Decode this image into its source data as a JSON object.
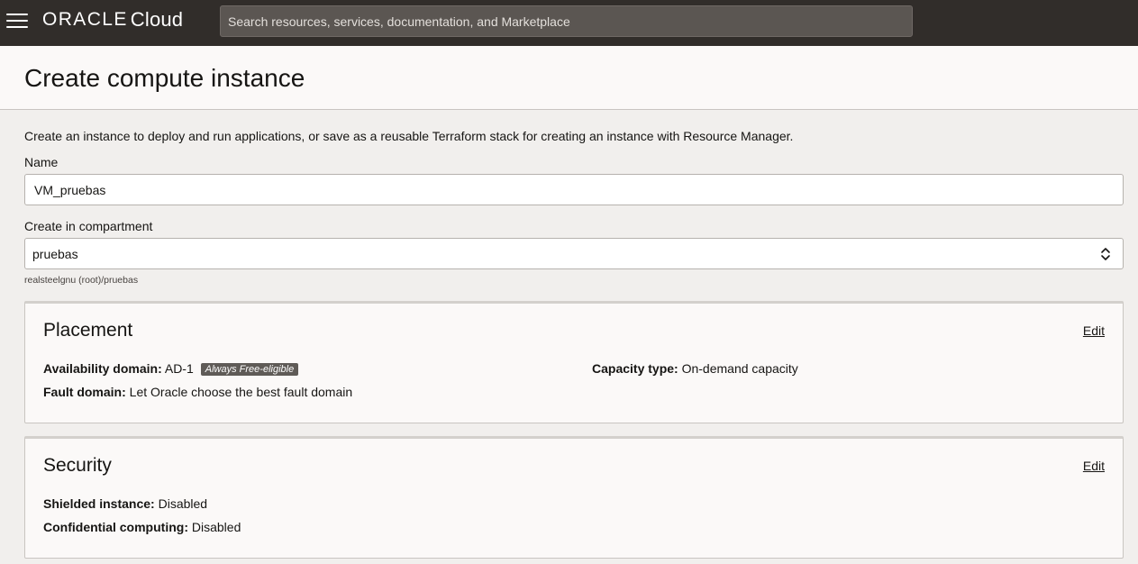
{
  "topbar": {
    "logo_brand": "ORACLE",
    "logo_product": "Cloud",
    "search_placeholder": "Search resources, services, documentation, and Marketplace"
  },
  "page": {
    "title": "Create compute instance",
    "intro": "Create an instance to deploy and run applications, or save as a reusable Terraform stack for creating an instance with Resource Manager."
  },
  "form": {
    "name_label": "Name",
    "name_value": "VM_pruebas",
    "compartment_label": "Create in compartment",
    "compartment_value": "pruebas",
    "compartment_path": "realsteelgnu (root)/pruebas"
  },
  "placement": {
    "title": "Placement",
    "edit_label": "Edit",
    "availability_domain_label": "Availability domain:",
    "availability_domain_value": "AD-1",
    "free_badge": "Always Free-eligible",
    "capacity_type_label": "Capacity type:",
    "capacity_type_value": "On-demand capacity",
    "fault_domain_label": "Fault domain:",
    "fault_domain_value": "Let Oracle choose the best fault domain"
  },
  "security": {
    "title": "Security",
    "edit_label": "Edit",
    "shielded_label": "Shielded instance:",
    "shielded_value": "Disabled",
    "confidential_label": "Confidential computing:",
    "confidential_value": "Disabled"
  },
  "colors": {
    "topbar_bg": "#312d2a",
    "page_bg": "#f1efed",
    "card_bg": "#fbf9f8",
    "badge_bg": "#5f5b57"
  }
}
